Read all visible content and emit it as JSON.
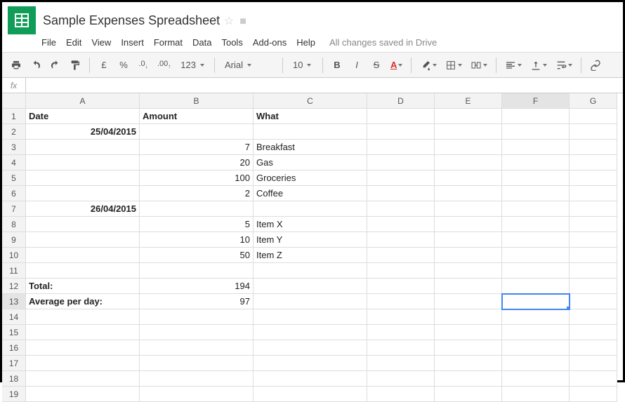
{
  "header": {
    "title": "Sample Expenses Spreadsheet",
    "status": "All changes saved in Drive"
  },
  "menus": {
    "file": "File",
    "edit": "Edit",
    "view": "View",
    "insert": "Insert",
    "format": "Format",
    "data": "Data",
    "tools": "Tools",
    "addons": "Add-ons",
    "help": "Help"
  },
  "toolbar": {
    "currency": "£",
    "percent": "%",
    "dec_dec": ".0",
    "inc_dec": ".00",
    "more_formats": "123",
    "font": "Arial",
    "size": "10",
    "bold": "B",
    "italic": "I",
    "strike": "S",
    "text_color": "A"
  },
  "formula_bar": {
    "label": "fx",
    "value": ""
  },
  "columns": [
    "A",
    "B",
    "C",
    "D",
    "E",
    "F",
    "G"
  ],
  "selected": {
    "col": "F",
    "row": 13
  },
  "rows": [
    {
      "n": 1,
      "A": "Date",
      "A_bold": true,
      "B": "Amount",
      "B_bold": true,
      "C": "What",
      "C_bold": true
    },
    {
      "n": 2,
      "A": "25/04/2015",
      "A_bold": true,
      "A_right": true
    },
    {
      "n": 3,
      "B": "7",
      "B_right": true,
      "C": "Breakfast"
    },
    {
      "n": 4,
      "B": "20",
      "B_right": true,
      "C": "Gas"
    },
    {
      "n": 5,
      "B": "100",
      "B_right": true,
      "C": "Groceries"
    },
    {
      "n": 6,
      "B": "2",
      "B_right": true,
      "C": "Coffee"
    },
    {
      "n": 7,
      "A": "26/04/2015",
      "A_bold": true,
      "A_right": true
    },
    {
      "n": 8,
      "B": "5",
      "B_right": true,
      "C": "Item X"
    },
    {
      "n": 9,
      "B": "10",
      "B_right": true,
      "C": "Item Y"
    },
    {
      "n": 10,
      "B": "50",
      "B_right": true,
      "C": "Item Z"
    },
    {
      "n": 11
    },
    {
      "n": 12,
      "A": "Total:",
      "A_bold": true,
      "B": "194",
      "B_right": true
    },
    {
      "n": 13,
      "A": "Average per day:",
      "A_bold": true,
      "B": "97",
      "B_right": true
    },
    {
      "n": 14
    },
    {
      "n": 15
    },
    {
      "n": 16
    },
    {
      "n": 17
    },
    {
      "n": 18
    },
    {
      "n": 19
    }
  ]
}
